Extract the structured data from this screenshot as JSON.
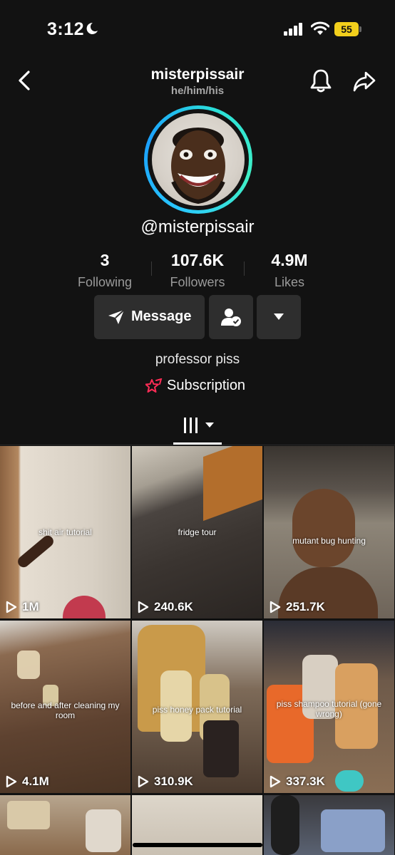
{
  "status_bar": {
    "time": "3:12",
    "battery": "55"
  },
  "header": {
    "username": "misterpissair",
    "pronouns": "he/him/his"
  },
  "profile": {
    "handle": "@misterpissair",
    "bio": "professor piss",
    "subscription_label": "Subscription"
  },
  "stats": [
    {
      "value": "3",
      "label": "Following"
    },
    {
      "value": "107.6K",
      "label": "Followers"
    },
    {
      "value": "4.9M",
      "label": "Likes"
    }
  ],
  "buttons": {
    "message": "Message"
  },
  "videos": [
    {
      "caption": "shit air tutorial",
      "views": "1M"
    },
    {
      "caption": "fridge tour",
      "views": "240.6K"
    },
    {
      "caption": "mutant bug hunting",
      "views": "251.7K"
    },
    {
      "caption": "before and after cleaning my room",
      "views": "4.1M"
    },
    {
      "caption": "piss honey pack tutorial",
      "views": "310.9K"
    },
    {
      "caption": "piss shampoo tutorial (gone wrong)",
      "views": "337.3K"
    }
  ],
  "colors": {
    "accent_ring": "#29c8ff",
    "battery": "#f2cf1c",
    "subscription_icon": "#fe2c55",
    "background": "#121212"
  }
}
